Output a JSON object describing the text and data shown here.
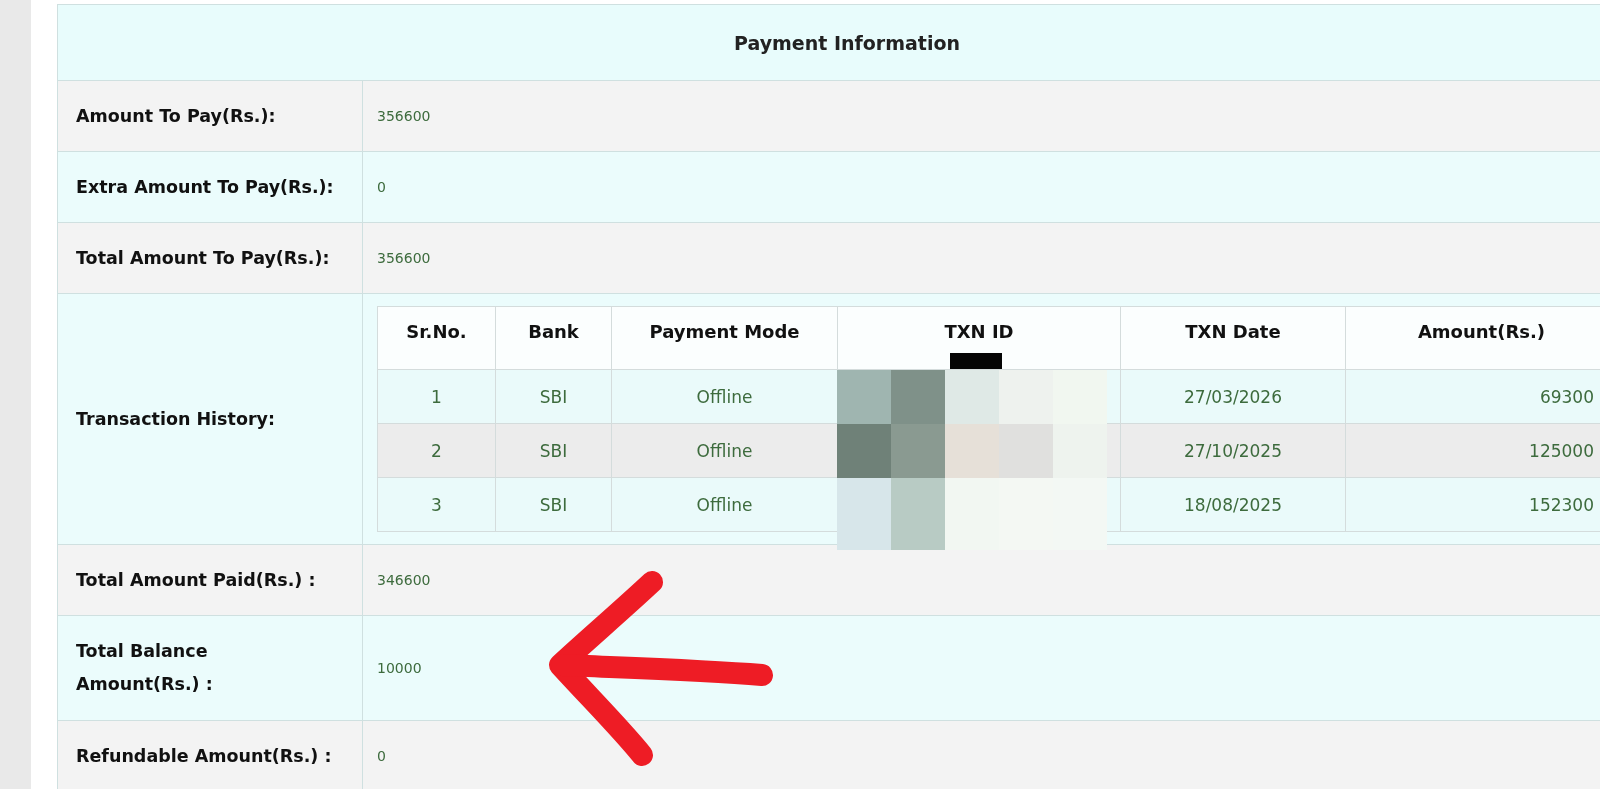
{
  "section_title": "Payment Information",
  "rows": [
    {
      "kind": "field",
      "label": "Amount To Pay(Rs.):",
      "value": "356600"
    },
    {
      "kind": "field",
      "label": "Extra Amount To Pay(Rs.):",
      "value": "0"
    },
    {
      "kind": "field",
      "label": "Total Amount To Pay(Rs.):",
      "value": "356600"
    },
    {
      "kind": "transactions",
      "label": "Transaction History:"
    },
    {
      "kind": "field",
      "label": "Total Amount Paid(Rs.) :",
      "value": "346600"
    },
    {
      "kind": "field",
      "label": "Total Balance Amount(Rs.) :",
      "value": "10000"
    },
    {
      "kind": "field",
      "label": "Refundable Amount(Rs.) :",
      "value": "0"
    }
  ],
  "transactions": {
    "columns": [
      "Sr.No.",
      "Bank",
      "Payment Mode",
      "TXN ID",
      "TXN Date",
      "Amount(Rs.)"
    ],
    "rows": [
      {
        "sr": "1",
        "bank": "SBI",
        "mode": "Offline",
        "date": "27/03/2026",
        "amount": "69300"
      },
      {
        "sr": "2",
        "bank": "SBI",
        "mode": "Offline",
        "date": "27/10/2025",
        "amount": "125000"
      },
      {
        "sr": "3",
        "bank": "SBI",
        "mode": "Offline",
        "date": "18/08/2025",
        "amount": "152300"
      }
    ]
  }
}
